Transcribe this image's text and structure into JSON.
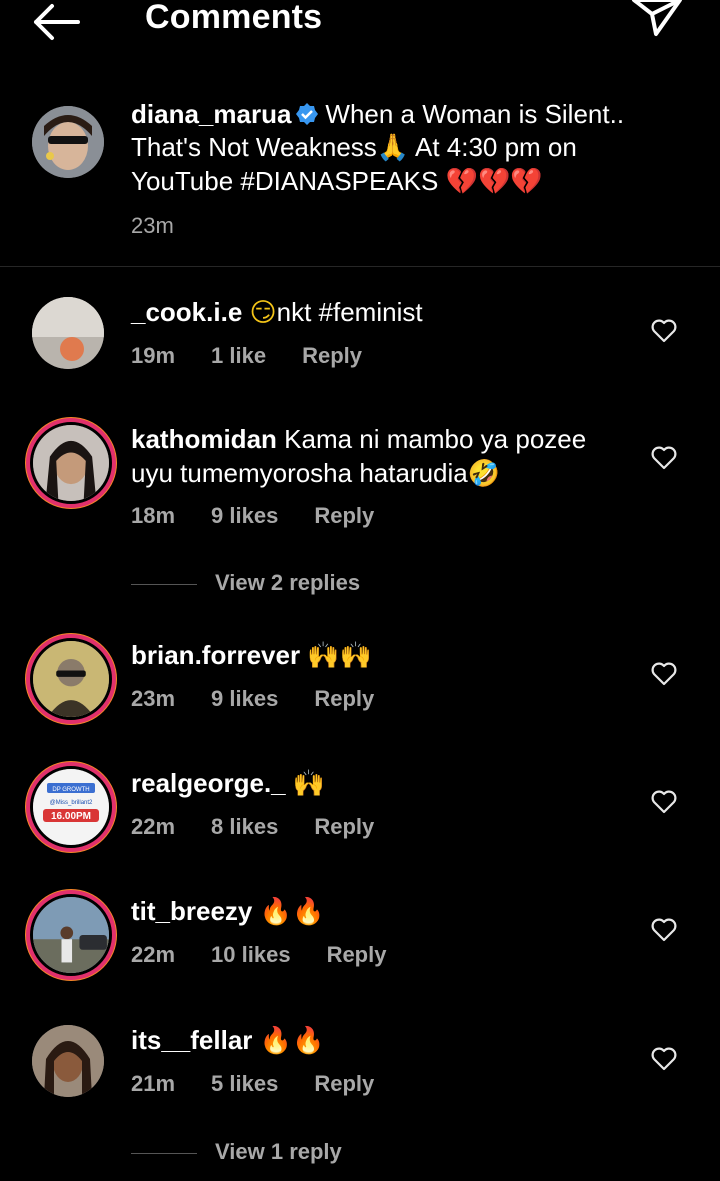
{
  "header": {
    "title": "Comments"
  },
  "caption": {
    "username": "diana_marua",
    "text_line1": "When a Woman is Silent..",
    "text_line2": "That's Not Weakness",
    "text_line2b": " At 4:30 pm on",
    "text_line3": "YouTube #DIANASPEAKS ",
    "time": "23m"
  },
  "comments": [
    {
      "username": "_cook.i.e",
      "text": "nkt  #feminist",
      "time": "19m",
      "likes": "1 like",
      "reply": "Reply"
    },
    {
      "username": "kathomidan",
      "text": "Kama ni mambo ya pozee uyu tumemyorosha hatarudia",
      "time": "18m",
      "likes": "9 likes",
      "reply": "Reply",
      "view_replies": "View 2 replies"
    },
    {
      "username": "brian.forrever",
      "text": "",
      "time": "23m",
      "likes": "9 likes",
      "reply": "Reply"
    },
    {
      "username": "realgeorge._",
      "text": "",
      "time": "22m",
      "likes": "8 likes",
      "reply": "Reply",
      "avatar_line1": "DP GROWTH",
      "avatar_line2": "@Miss_brillant2",
      "avatar_line3": "16.00PM"
    },
    {
      "username": "tit_breezy",
      "text": "",
      "time": "22m",
      "likes": "10 likes",
      "reply": "Reply"
    },
    {
      "username": "its__fellar",
      "text": "",
      "time": "21m",
      "likes": "5 likes",
      "reply": "Reply",
      "view_replies": "View 1 reply"
    }
  ],
  "icons": {
    "back": "arrow-left-icon",
    "send": "paper-plane-icon",
    "like": "heart-outline-icon",
    "verified": "verified-badge-icon"
  },
  "colors": {
    "background": "#000000",
    "text": "#ffffff",
    "secondary": "#a8a8a8",
    "verified": "#3897f0",
    "story_ring": "#e1306c"
  }
}
